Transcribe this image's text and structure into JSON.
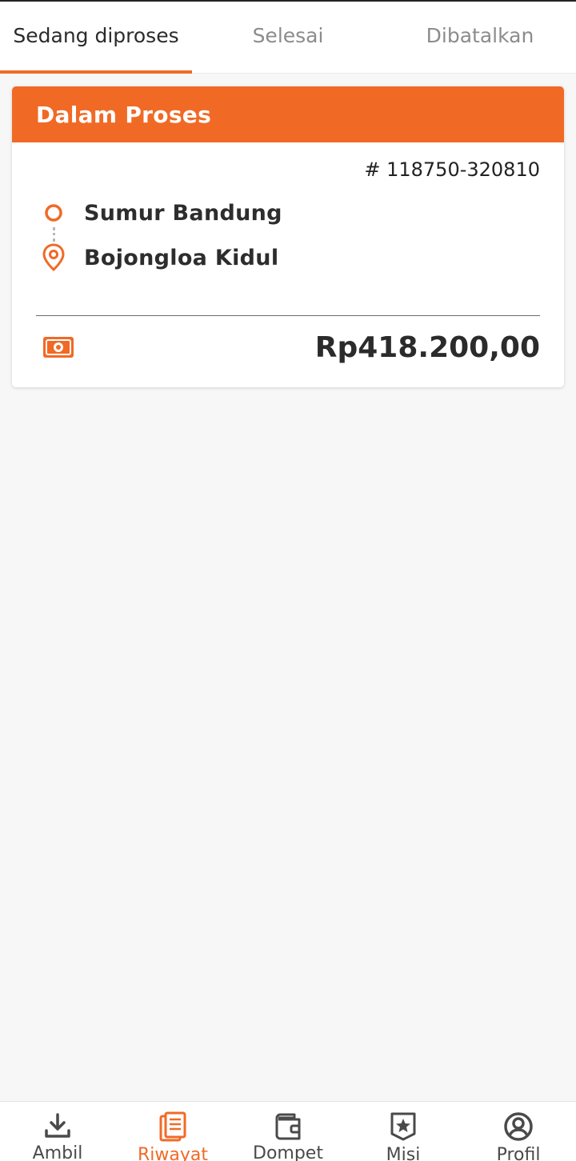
{
  "tabs": [
    {
      "label": "Sedang diproses",
      "active": true
    },
    {
      "label": "Selesai",
      "active": false
    },
    {
      "label": "Dibatalkan",
      "active": false
    }
  ],
  "order": {
    "status": "Dalam Proses",
    "id": "# 118750-320810",
    "origin": "Sumur Bandung",
    "destination": "Bojongloa Kidul",
    "price": "Rp418.200,00"
  },
  "nav": {
    "items": [
      {
        "label": "Ambil",
        "icon": "download-icon"
      },
      {
        "label": "Riwayat",
        "icon": "history-icon",
        "active": true
      },
      {
        "label": "Dompet",
        "icon": "wallet-icon"
      },
      {
        "label": "Misi",
        "icon": "mission-star-icon"
      },
      {
        "label": "Profil",
        "icon": "profile-icon"
      }
    ]
  },
  "colors": {
    "accent": "#f06a26",
    "background": "#f7f7f7",
    "text": "#2b2b2b",
    "muted": "#8c8c8c"
  }
}
